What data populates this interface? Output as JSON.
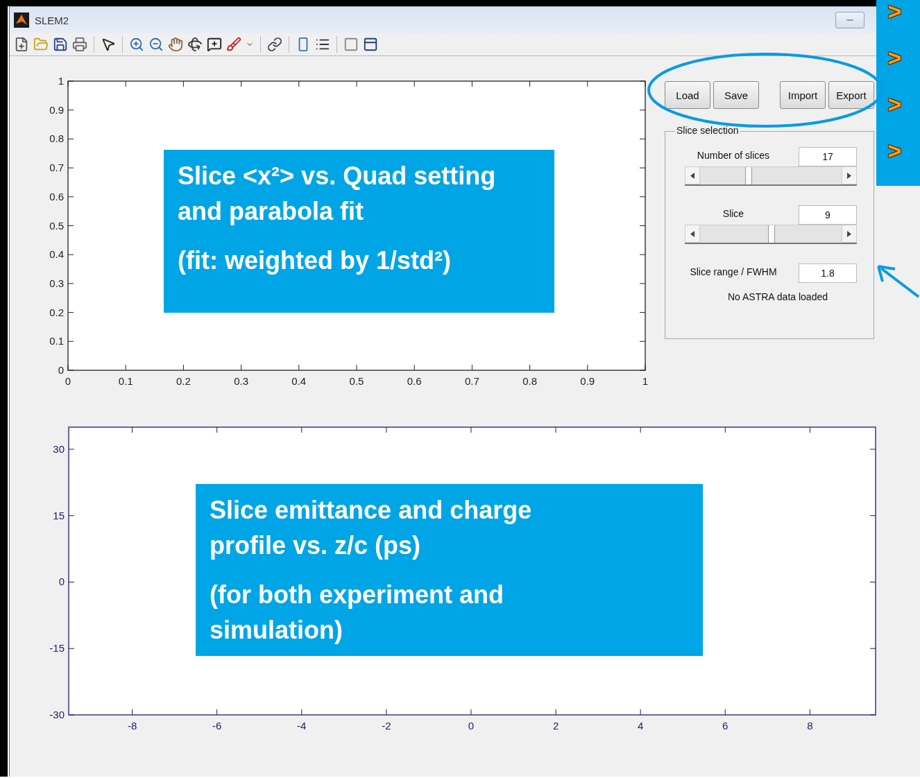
{
  "window": {
    "title": "SLEM2"
  },
  "top_plot": {
    "chart_data": {
      "type": "line",
      "xlim": [
        0,
        1
      ],
      "ylim": [
        0,
        1
      ],
      "xticks": [
        0,
        0.1,
        0.2,
        0.3,
        0.4,
        0.5,
        0.6,
        0.7,
        0.8,
        0.9,
        1
      ],
      "yticks": [
        0,
        0.1,
        0.2,
        0.3,
        0.4,
        0.5,
        0.6,
        0.7,
        0.8,
        0.9,
        1
      ]
    }
  },
  "buttons": [
    {
      "label": "Load"
    },
    {
      "label": "Save"
    },
    {
      "label": "Import"
    },
    {
      "label": "Export"
    }
  ],
  "slice_selection": {
    "title": "Slice selection",
    "controls": [
      {
        "kind": "slider",
        "label": "Number of slices",
        "value": "17",
        "level": 0.33
      },
      {
        "kind": "slider",
        "label": "Slice",
        "value": "9",
        "level": 0.5
      },
      {
        "kind": "field",
        "label": "Slice range / FWHM",
        "value": "1.8"
      }
    ],
    "status": "No ASTRA data loaded"
  },
  "bottom_plot": {
    "chart_data": {
      "type": "line",
      "xlim": [
        -9.5,
        9.55
      ],
      "ylim": [
        -30,
        35
      ],
      "xticks": [
        -8,
        -6,
        -4,
        -2,
        0,
        2,
        4,
        6,
        8
      ],
      "yticks": [
        -30,
        -15,
        0,
        15,
        30
      ]
    }
  },
  "annotations": [
    {
      "paragraphs": [
        "Slice <x²> vs. Quad setting and parabola fit",
        "(fit: weighted by 1/std²)"
      ]
    },
    {
      "paragraphs": [
        "Slice emittance and charge profile vs. z/c (ps)",
        "(for both experiment and simulation)"
      ]
    }
  ],
  "side_markers": [
    ">",
    ">",
    ">",
    ">"
  ]
}
